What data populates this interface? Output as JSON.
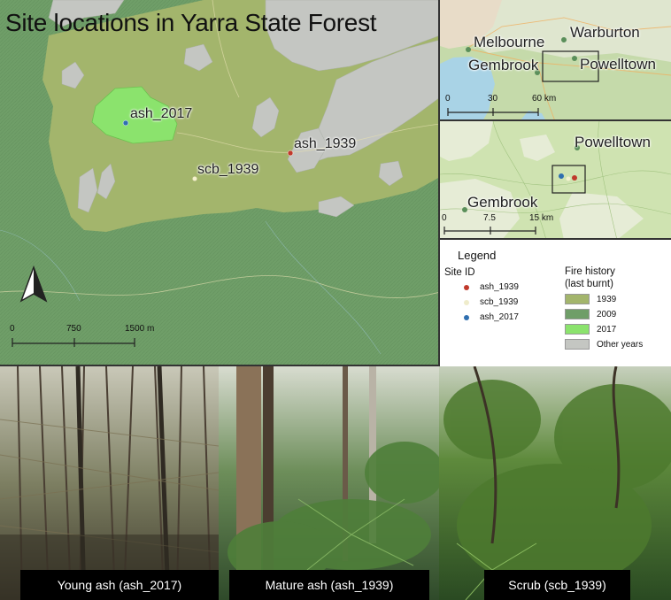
{
  "main_map": {
    "title": "Site locations in Yarra State Forest",
    "sites": [
      {
        "id": "ash_2017",
        "label": "ash_2017",
        "color": "#2f6fb0"
      },
      {
        "id": "ash_1939",
        "label": "ash_1939",
        "color": "#c0392b"
      },
      {
        "id": "scb_1939",
        "label": "scb_1939",
        "color": "#f4f2cf"
      }
    ],
    "scale_bar": {
      "labels": [
        "0",
        "750",
        "1500 m"
      ]
    },
    "north_arrow": "north-arrow-icon"
  },
  "inset_regional": {
    "towns": [
      "Melbourne",
      "Warburton",
      "Gembrook",
      "Powelltown"
    ],
    "scale_bar": {
      "labels": [
        "0",
        "30",
        "60 km"
      ]
    }
  },
  "inset_local": {
    "towns": [
      "Powelltown",
      "Gembrook"
    ],
    "scale_bar": {
      "labels": [
        "0",
        "7.5",
        "15 km"
      ]
    }
  },
  "legend": {
    "title": "Legend",
    "site_heading": "Site ID",
    "sites": [
      {
        "label": "ash_1939",
        "color": "#c0392b"
      },
      {
        "label": "scb_1939",
        "color": "#efeccb"
      },
      {
        "label": "ash_2017",
        "color": "#2f6fb0"
      }
    ],
    "fire_heading": "Fire history\n(last burnt)",
    "fire_classes": [
      {
        "label": "1939",
        "color": "#a3b56c"
      },
      {
        "label": "2009",
        "color": "#6f9e68"
      },
      {
        "label": "2017",
        "color": "#8be36d"
      },
      {
        "label": "Other years",
        "color": "#c4c6c2"
      }
    ]
  },
  "photos": [
    {
      "caption": "Young ash (ash_2017)"
    },
    {
      "caption": "Mature ash (ash_1939)"
    },
    {
      "caption": "Scrub (scb_1939)"
    }
  ]
}
